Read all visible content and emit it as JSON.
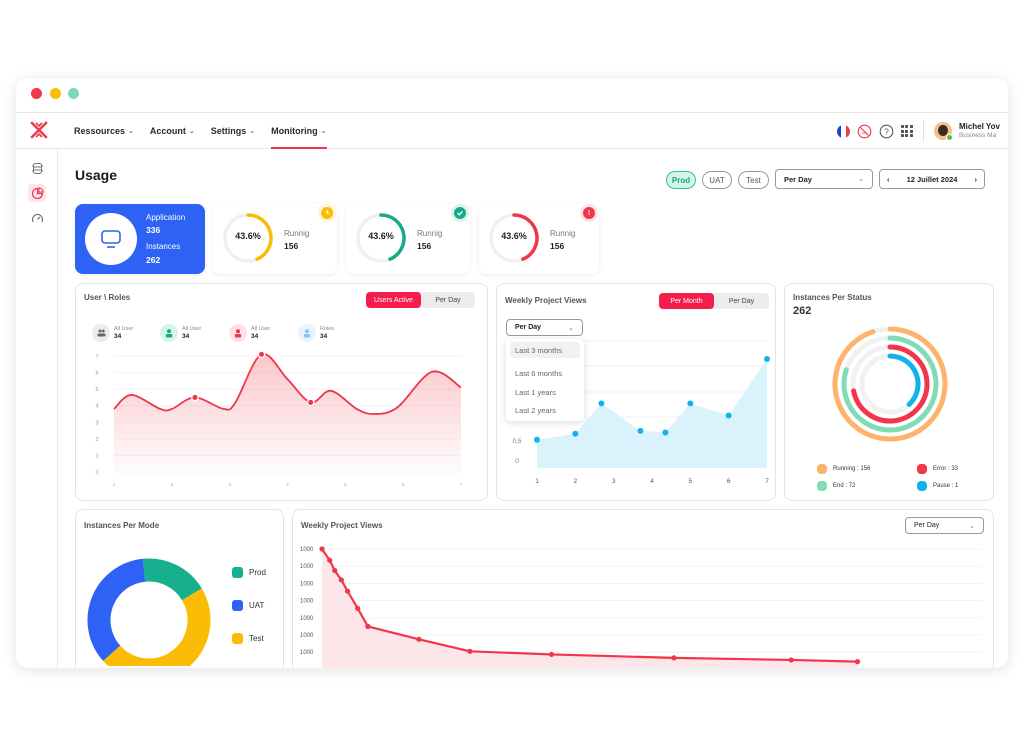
{
  "window": {
    "controls": [
      "close",
      "minimize",
      "maximize"
    ]
  },
  "nav": {
    "logo": "x-logo",
    "menu": [
      {
        "label": "Ressources",
        "active": false
      },
      {
        "label": "Account",
        "active": false
      },
      {
        "label": "Settings",
        "active": false
      },
      {
        "label": "Monitoring",
        "active": true
      }
    ],
    "chevron": "⌄",
    "user": {
      "name": "Michel Yov",
      "role": "Business Ma",
      "status": "online"
    },
    "icons": [
      "french-flag-icon",
      "no-smoking-icon",
      "help-icon",
      "apps-grid-icon"
    ]
  },
  "sidebar": {
    "items": [
      {
        "icon": "server-icon",
        "active": false
      },
      {
        "icon": "pie-chart-icon",
        "active": true
      },
      {
        "icon": "speedometer-icon",
        "active": false
      }
    ]
  },
  "page": {
    "title": "Usage",
    "env_filters": [
      {
        "label": "Prod",
        "active": true
      },
      {
        "label": "UAT",
        "active": false
      },
      {
        "label": "Test",
        "active": false
      }
    ],
    "period_select": {
      "value": "Per Day"
    },
    "date": {
      "value": "12 Juillet 2024",
      "prev": "‹",
      "next": "›"
    }
  },
  "summary": {
    "application": {
      "label": "Application",
      "value": "336"
    },
    "instances": {
      "label": "Instances",
      "value": "262"
    },
    "gauges": [
      {
        "percent": 43.6,
        "percent_label": "43.6%",
        "label": "Runnig",
        "value": "156",
        "color": "#fbbc05",
        "badge": "clock-icon",
        "badge_bg": "#fbbc05"
      },
      {
        "percent": 43.6,
        "percent_label": "43.6%",
        "label": "Runnig",
        "value": "156",
        "color": "#17a98a",
        "badge": "check-icon",
        "badge_bg": "#17a98a"
      },
      {
        "percent": 43.6,
        "percent_label": "43.6%",
        "label": "Runnig",
        "value": "156",
        "color": "#f0364a",
        "badge": "alert-icon",
        "badge_bg": "#f0364a"
      }
    ]
  },
  "user_roles": {
    "title": "User \\ Roles",
    "toggle": [
      {
        "label": "Users Active",
        "active": true
      },
      {
        "label": "Per Day",
        "active": false
      }
    ],
    "stats": [
      {
        "label": "All User",
        "value": "34",
        "icon": "users-icon",
        "bg": "#ececec",
        "fg": "#555"
      },
      {
        "label": "All User",
        "value": "34",
        "icon": "user-icon",
        "bg": "#d8f5ec",
        "fg": "#17a98a"
      },
      {
        "label": "All User",
        "value": "34",
        "icon": "user-icon",
        "bg": "#fde2e5",
        "fg": "#f0364a"
      },
      {
        "label": "Roles",
        "value": "34",
        "icon": "user-icon",
        "bg": "#e8f3fd",
        "fg": "#8cc4f5"
      }
    ]
  },
  "weekly_views": {
    "title": "Weekly Project Views",
    "toggle": [
      {
        "label": "Per Month",
        "active": true
      },
      {
        "label": "Per Day",
        "active": false
      }
    ],
    "select": {
      "value": "Per Day"
    },
    "dropdown": {
      "open": true,
      "options": [
        {
          "label": "Last 3 months",
          "hover": true
        },
        {
          "label": "Last 6 months",
          "hover": false
        },
        {
          "label": "Last 1 years",
          "hover": false
        },
        {
          "label": "Last 2 years",
          "hover": false
        }
      ]
    }
  },
  "instances_status": {
    "title": "Instances Per Status",
    "total": "262",
    "legend": [
      {
        "label": "Running : 156",
        "color": "#fdb36b"
      },
      {
        "label": "Error : 33",
        "color": "#f0364a"
      },
      {
        "label": "End : 72",
        "color": "#7fdcb5"
      },
      {
        "label": "Pause : 1",
        "color": "#0fb4ef"
      }
    ]
  },
  "instances_mode": {
    "title": "Instances Per Mode",
    "legend": [
      {
        "label": "Prod",
        "color": "#17b08e"
      },
      {
        "label": "UAT",
        "color": "#2d62f5"
      },
      {
        "label": "Test",
        "color": "#fbbc05"
      }
    ]
  },
  "weekly_views_2": {
    "title": "Weekly Project Views",
    "select": {
      "value": "Per Day"
    }
  },
  "chart_data": [
    {
      "type": "area",
      "title": "User \\ Roles",
      "x": [
        1,
        2,
        3,
        4,
        5,
        6,
        7
      ],
      "yticks": [
        "0",
        "1",
        "2",
        "3",
        "4",
        "5",
        "6",
        "7"
      ],
      "ylim": [
        0,
        7
      ],
      "series": [
        {
          "name": "Users Active",
          "color": "#f0364a",
          "points": [
            [
              1,
              3.8
            ],
            [
              1.3,
              4.65
            ],
            [
              1.8,
              3.8
            ],
            [
              2.0,
              3.8
            ],
            [
              2.4,
              4.5
            ],
            [
              2.9,
              3.8
            ],
            [
              3.1,
              4.2
            ],
            [
              3.55,
              7.1
            ],
            [
              4.0,
              5.6
            ],
            [
              4.4,
              4.2
            ],
            [
              4.75,
              4.9
            ],
            [
              5.2,
              3.8
            ],
            [
              5.5,
              3.5
            ],
            [
              5.9,
              3.9
            ],
            [
              6.5,
              6.05
            ],
            [
              7.0,
              5.1
            ]
          ],
          "markers": [
            [
              2.4,
              4.5
            ],
            [
              3.55,
              7.1
            ],
            [
              4.4,
              4.2
            ]
          ]
        }
      ],
      "grid": true
    },
    {
      "type": "area",
      "title": "Weekly Project Views",
      "x": [
        1,
        2,
        3,
        4,
        5,
        6,
        7
      ],
      "xticks": [
        "1",
        "2",
        "3",
        "4",
        "5",
        "6",
        "7"
      ],
      "yticks": [
        "0",
        "0,5",
        "0,5"
      ],
      "ylim": [
        0,
        3
      ],
      "series": [
        {
          "name": "Views",
          "color": "#0fb4ef",
          "points": [
            [
              1,
              0.5
            ],
            [
              2,
              0.65
            ],
            [
              2.68,
              1.4
            ],
            [
              3.7,
              0.72
            ],
            [
              4.35,
              0.68
            ],
            [
              5,
              1.4
            ],
            [
              6,
              1.1
            ],
            [
              7,
              2.5
            ]
          ]
        }
      ],
      "grid": true
    },
    {
      "type": "pie",
      "title": "Instances Per Status",
      "variant": "radial-bar",
      "slices": [
        {
          "label": "Running",
          "value": 156,
          "fraction": 0.95,
          "color": "#fdb36b"
        },
        {
          "label": "End",
          "value": 72,
          "fraction": 0.8,
          "color": "#7fdcb5"
        },
        {
          "label": "Error",
          "value": 33,
          "fraction": 0.72,
          "color": "#f0364a"
        },
        {
          "label": "Pause",
          "value": 1,
          "fraction": 0.38,
          "color": "#0fb4ef"
        }
      ]
    },
    {
      "type": "pie",
      "title": "Instances Per Mode",
      "variant": "donut",
      "slices": [
        {
          "label": "Prod",
          "fraction": 0.18,
          "color": "#17b08e"
        },
        {
          "label": "Test",
          "fraction": 0.47,
          "color": "#fbbc05"
        },
        {
          "label": "UAT",
          "fraction": 0.35,
          "color": "#2d62f5"
        }
      ]
    },
    {
      "type": "area",
      "title": "Weekly Project Views",
      "yticks": [
        "1000",
        "1000",
        "1000",
        "1000",
        "1000",
        "1000",
        "1000"
      ],
      "ylim": [
        0,
        7
      ],
      "series": [
        {
          "name": "Views",
          "color": "#f0364a",
          "points": [
            [
              0,
              6.95
            ],
            [
              0.15,
              6.3
            ],
            [
              0.25,
              5.7
            ],
            [
              0.38,
              5.15
            ],
            [
              0.5,
              4.5
            ],
            [
              0.7,
              3.5
            ],
            [
              0.9,
              2.45
            ],
            [
              1.9,
              1.7
            ],
            [
              2.9,
              1.0
            ],
            [
              4.5,
              0.82
            ],
            [
              6.9,
              0.62
            ],
            [
              9.2,
              0.5
            ],
            [
              10.5,
              0.4
            ]
          ]
        }
      ],
      "grid": true
    }
  ]
}
